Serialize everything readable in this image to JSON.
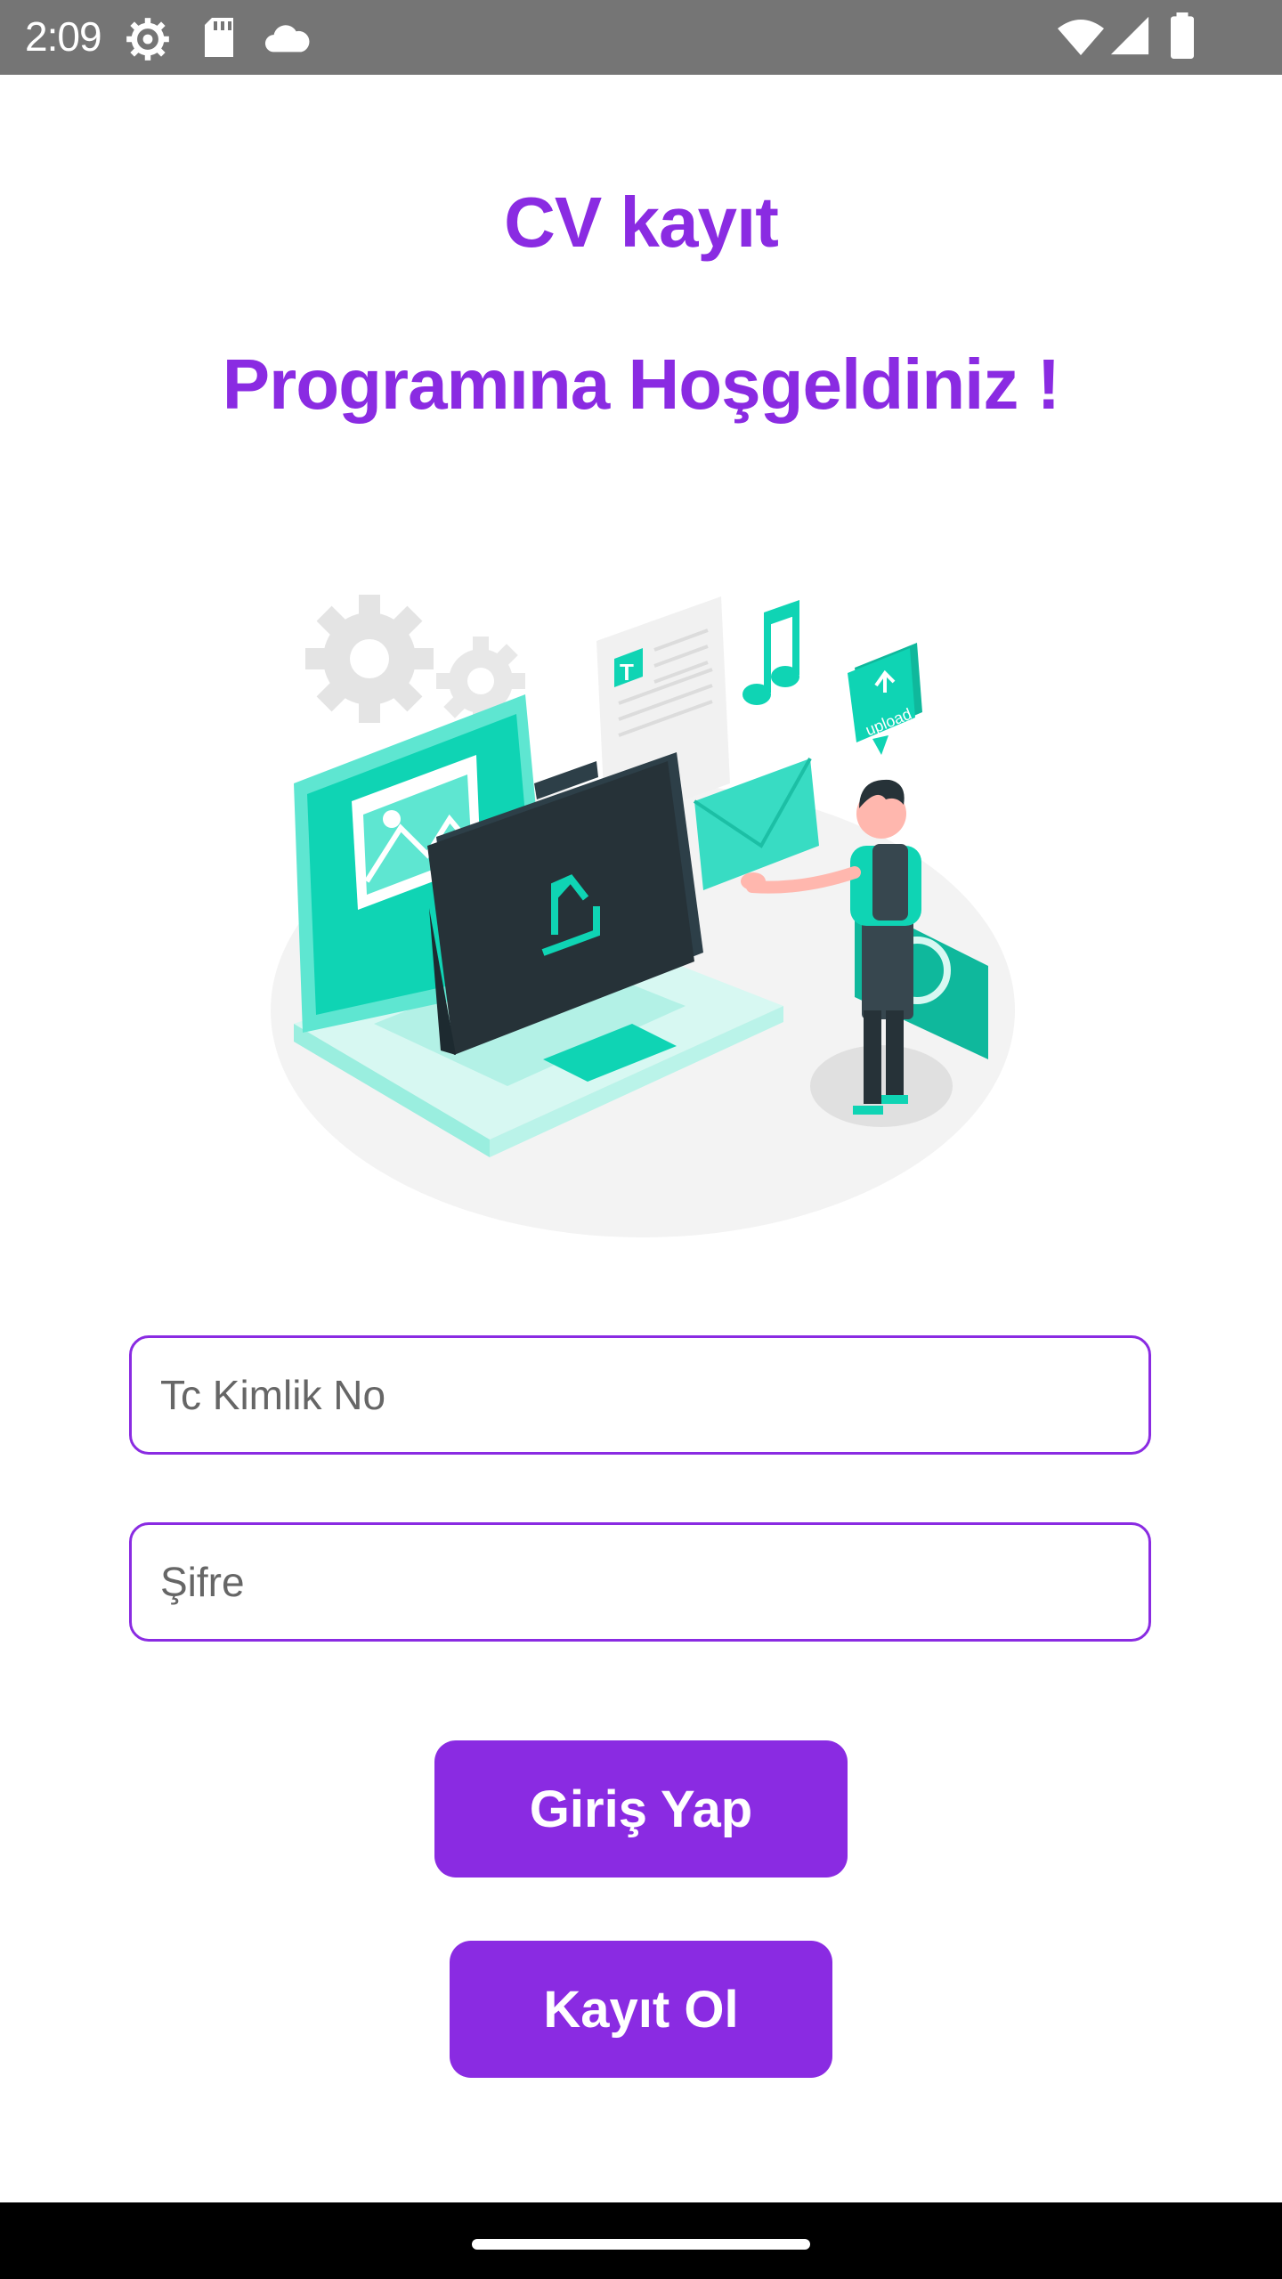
{
  "status_bar": {
    "time": "2:09",
    "left_icons": [
      "settings-icon",
      "sd-card-icon",
      "cloud-icon"
    ],
    "right_icons": [
      "wifi-icon",
      "signal-icon",
      "battery-icon"
    ]
  },
  "header": {
    "line1": "CV kayıt",
    "line2": "Programına Hoşgeldiniz !"
  },
  "illustration": {
    "text_badge": "upload",
    "doc_letter": "T"
  },
  "form": {
    "tc_placeholder": "Tc Kimlik No",
    "password_placeholder": "Şifre"
  },
  "actions": {
    "login_label": "Giriş Yap",
    "register_label": "Kayıt Ol"
  },
  "colors": {
    "accent": "#8A2BE2",
    "illustration_teal": "#0FD4B4",
    "status_bar": "#757575"
  }
}
